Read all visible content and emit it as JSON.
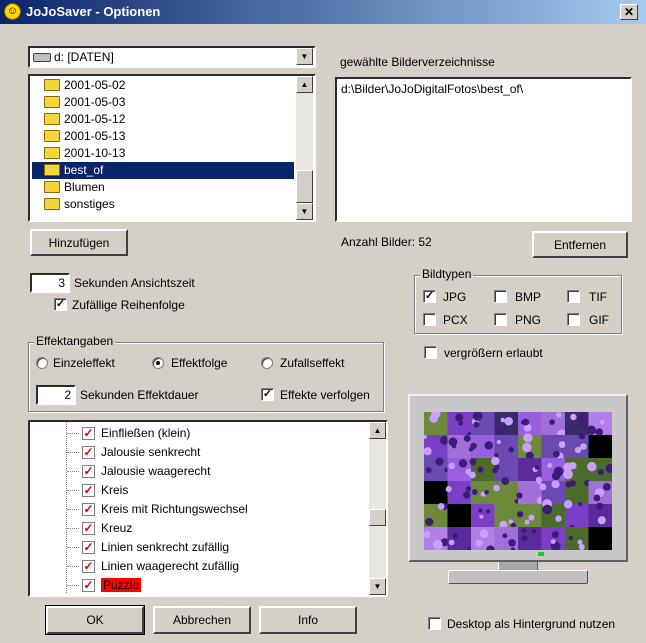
{
  "window": {
    "title": "JoJoSaver - Optionen",
    "close_glyph": "✕"
  },
  "drive": {
    "value": "d: [DATEN]"
  },
  "folders": [
    "2001-05-02",
    "2001-05-03",
    "2001-05-12",
    "2001-05-13",
    "2001-10-13",
    "best_of",
    "Blumen",
    "sonstiges"
  ],
  "selected_folder": "best_of",
  "selected_dirs": {
    "label": "gewählte Bilderverzeichnisse",
    "items": [
      "d:\\Bilder\\JoJoDigitalFotos\\best_of\\"
    ]
  },
  "buttons": {
    "add": "Hinzufügen",
    "remove": "Entfernen",
    "ok": "OK",
    "cancel": "Abbrechen",
    "info": "Info"
  },
  "image_count": "Anzahl Bilder: 52",
  "view_time": {
    "value": "3",
    "label": "Sekunden Ansichtszeit"
  },
  "random_order": {
    "label": "Zufällige Reihenfolge",
    "checked": true
  },
  "image_types": {
    "legend": "Bildtypen",
    "jpg": "JPG",
    "bmp": "BMP",
    "tif": "TIF",
    "pcx": "PCX",
    "png": "PNG",
    "gif": "GIF"
  },
  "enlarge": {
    "label": "vergrößern erlaubt",
    "checked": false
  },
  "effects": {
    "legend": "Effektangaben",
    "single": "Einzeleffekt",
    "sequence": "Effektfolge",
    "random": "Zufallseffekt",
    "duration_value": "2",
    "duration_label": "Sekunden Effektdauer",
    "follow_label": "Effekte verfolgen"
  },
  "effect_list": [
    "Einfließen (klein)",
    "Jalousie senkrecht",
    "Jalousie waagerecht",
    "Kreis",
    "Kreis mit Richtungswechsel",
    "Kreuz",
    "Linien senkrecht zufällig",
    "Linien waagerecht zufällig",
    "Puzzle"
  ],
  "desktop_bg": {
    "label": "Desktop als Hintergrund nutzen",
    "checked": false
  },
  "colors": {
    "title_start": "#0a246a",
    "title_end": "#a6caf0",
    "selection": "#0a246a",
    "highlight_red": "#ff0000",
    "face": "#d4d0c8"
  },
  "icons": {
    "app": "smiley-icon",
    "drive": "drive-icon",
    "folder": "folder-icon",
    "check": "checkmark-icon"
  }
}
